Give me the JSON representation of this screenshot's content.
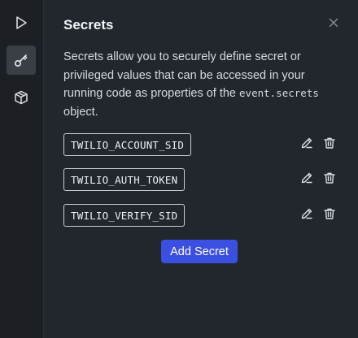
{
  "rail": {
    "items": [
      {
        "icon": "play-icon",
        "active": false
      },
      {
        "icon": "key-icon",
        "active": true
      },
      {
        "icon": "package-icon",
        "active": false
      }
    ]
  },
  "panel": {
    "title": "Secrets",
    "close_icon": "close-icon",
    "description_before_code": "Secrets allow you to securely define secret or privileged values that can be accessed in your running code as properties of the ",
    "description_code": "event.secrets",
    "description_after_code": " object."
  },
  "secrets": [
    {
      "name": "TWILIO_ACCOUNT_SID"
    },
    {
      "name": "TWILIO_AUTH_TOKEN"
    },
    {
      "name": "TWILIO_VERIFY_SID"
    }
  ],
  "actions": {
    "edit_icon": "pencil-icon",
    "delete_icon": "trash-icon",
    "add_label": "Add Secret",
    "add_color": "#3b4fe0"
  }
}
